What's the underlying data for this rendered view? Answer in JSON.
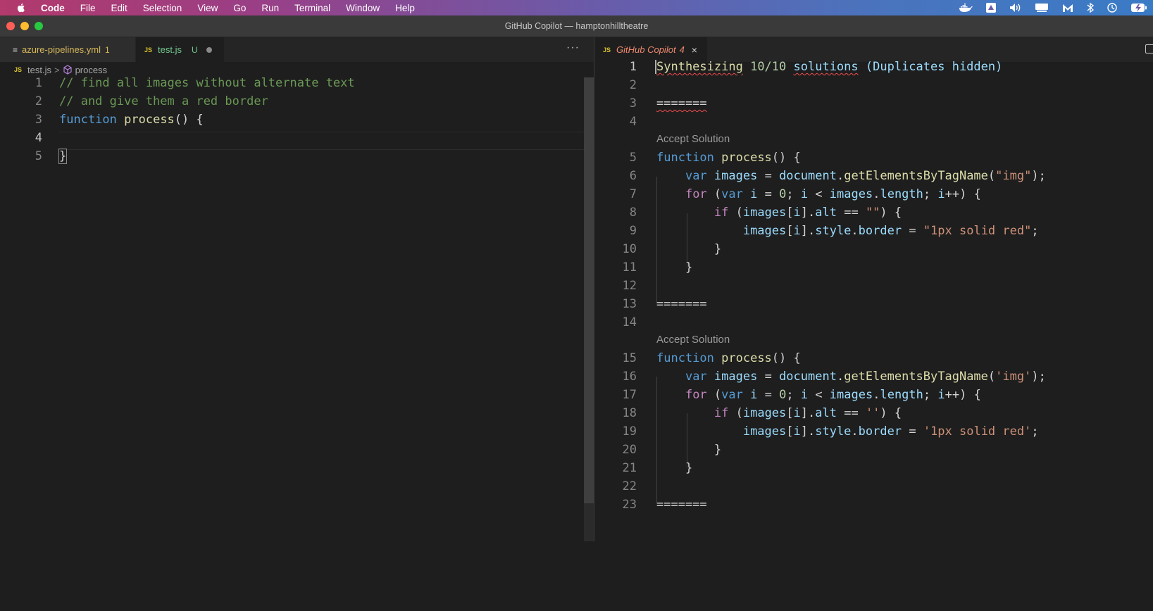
{
  "menubar": {
    "items": [
      "Code",
      "File",
      "Edit",
      "Selection",
      "View",
      "Go",
      "Run",
      "Terminal",
      "Window",
      "Help"
    ],
    "tray_icons": [
      "docker-icon",
      "drive-icon",
      "volume-icon",
      "display-icon",
      "malwarebytes-icon",
      "bluetooth-icon",
      "time-machine-icon",
      "battery-icon"
    ]
  },
  "window": {
    "title": "GitHub Copilot — hamptonhilltheatre"
  },
  "left_group": {
    "tabs": [
      {
        "icon": "≡",
        "label": "azure-pipelines.yml",
        "badge": "1"
      },
      {
        "icon": "JS",
        "label": "test.js",
        "badge": "U"
      }
    ],
    "more": "···",
    "breadcrumb": {
      "icon": "JS",
      "file": "test.js",
      "sep": ">",
      "symbol": "process"
    },
    "lines": [
      {
        "num": "1",
        "text": "// find all images without alternate text"
      },
      {
        "num": "2",
        "text": "// and give them a red border"
      },
      {
        "num": "3",
        "keyword": "function",
        "name": "process",
        "rest": "() {"
      },
      {
        "num": "4",
        "text": ""
      },
      {
        "num": "5",
        "text": "}"
      }
    ]
  },
  "right_group": {
    "tab": {
      "icon": "JS",
      "label": "GitHub Copilot",
      "badge": "4",
      "close": "×"
    },
    "header_line": {
      "w1": "Synthesizing",
      "count": "10/10",
      "w3": "solutions",
      "paren": "(Duplicates hidden)"
    },
    "separator": "=======",
    "accept_label": "Accept Solution",
    "line_numbers": [
      "1",
      "2",
      "3",
      "4",
      "5",
      "6",
      "7",
      "8",
      "9",
      "10",
      "11",
      "12",
      "13",
      "14",
      "15",
      "16",
      "17",
      "18",
      "19",
      "20",
      "21",
      "22",
      "23"
    ],
    "solution_1": {
      "tag": "\"img\"",
      "empty": "\"\"",
      "border": "\"1px solid red\""
    },
    "solution_2": {
      "tag": "'img'",
      "empty": "''",
      "border": "'1px solid red'"
    },
    "tokens": {
      "function": "function",
      "process": "process",
      "var": "var",
      "images": "images",
      "document": "document",
      "getElementsByTagName": "getElementsByTagName",
      "for": "for",
      "i": "i",
      "zero": "0",
      "length": "length",
      "if": "if",
      "alt": "alt",
      "style": "style",
      "border": "border"
    }
  }
}
